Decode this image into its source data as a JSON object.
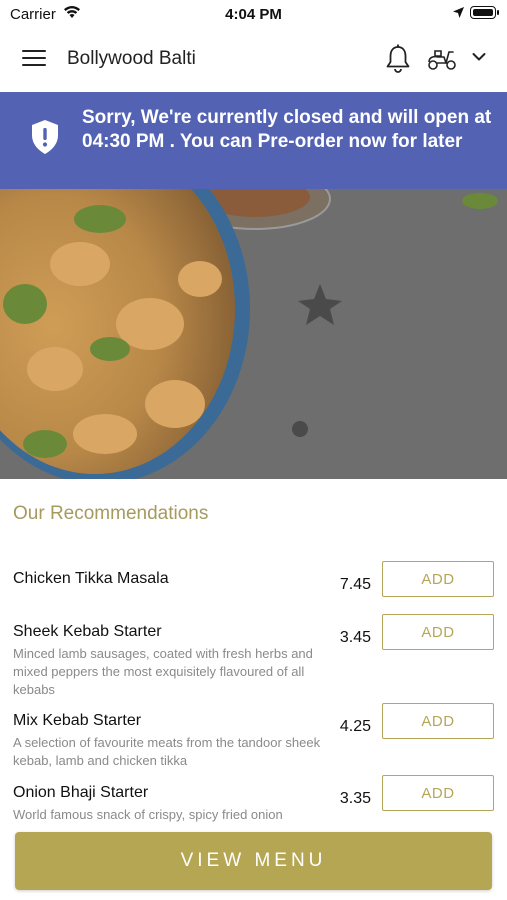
{
  "status_bar": {
    "carrier": "Carrier",
    "time": "4:04 PM"
  },
  "header": {
    "title": "Bollywood Balti"
  },
  "banner": {
    "message": "Sorry, We're currently closed and will open at 04:30 PM . You can Pre-order now for later",
    "color": "#5462b4"
  },
  "recommendations": {
    "title": "Our Recommendations",
    "items": [
      {
        "name": "Chicken Tikka Masala",
        "description": "",
        "price": "7.45",
        "button": "ADD"
      },
      {
        "name": "Sheek Kebab Starter",
        "description": "Minced lamb sausages, coated with fresh herbs and mixed peppers the most exquisitely flavoured of all kebabs",
        "price": "3.45",
        "button": "ADD"
      },
      {
        "name": "Mix Kebab Starter",
        "description": "A selection of favourite meats from the tandoor sheek kebab, lamb and chicken tikka",
        "price": "4.25",
        "button": "ADD"
      },
      {
        "name": "Onion Bhaji Starter",
        "description": "World famous snack of crispy, spicy fried onion",
        "price": "3.35",
        "button": "ADD"
      }
    ]
  },
  "footer": {
    "view_menu": "VIEW MENU"
  },
  "colors": {
    "accent": "#b5a653",
    "banner": "#5462b4"
  }
}
